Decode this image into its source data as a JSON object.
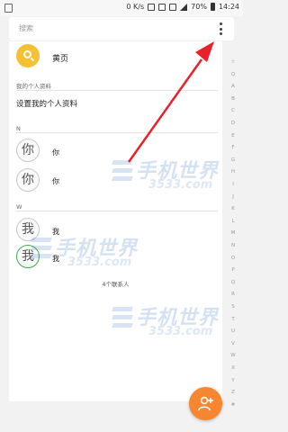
{
  "status_bar": {
    "network_speed": "0 K/s",
    "battery": "70%",
    "time": "14:24"
  },
  "search": {
    "placeholder": "搜索"
  },
  "yellow_pages": {
    "label": "黄页"
  },
  "my_profile": {
    "section_label": "我的个人资料",
    "setup_label": "设置我的个人资料"
  },
  "groups": [
    {
      "letter": "N",
      "contacts": [
        {
          "avatar_char": "你",
          "name": "你"
        },
        {
          "avatar_char": "你",
          "name": "你"
        }
      ]
    },
    {
      "letter": "W",
      "contacts": [
        {
          "avatar_char": "我",
          "name": "我"
        },
        {
          "avatar_char": "我",
          "name": "我"
        }
      ]
    }
  ],
  "contact_count": "4个联系人",
  "index_letters": [
    "☆",
    "Q",
    "A",
    "B",
    "C",
    "D",
    "E",
    "F",
    "G",
    "H",
    "I",
    "J",
    "K",
    "L",
    "M",
    "N",
    "O",
    "P",
    "Q",
    "R",
    "S",
    "T",
    "U",
    "V",
    "W",
    "X",
    "Y",
    "Z",
    "#"
  ],
  "watermark": {
    "brand": "手机世界",
    "number": "3533.com"
  },
  "colors": {
    "accent_orange": "#f6862f",
    "yellow_avatar": "#f5c033",
    "arrow_red": "#e8222a",
    "highlight_green": "#3fae52"
  },
  "icons": {
    "more": "more-vertical-icon",
    "search": "search-icon",
    "add_contact": "add-contact-icon"
  }
}
